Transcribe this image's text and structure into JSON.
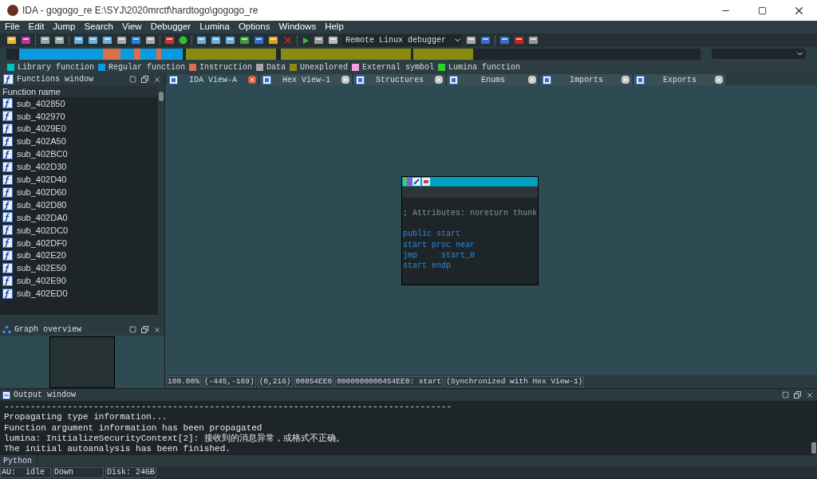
{
  "window": {
    "title": "IDA - gogogo_re E:\\SYJ\\2020mrctf\\hardtogo\\gogogo_re"
  },
  "menu": [
    "File",
    "Edit",
    "Jump",
    "Search",
    "View",
    "Debugger",
    "Lumina",
    "Options",
    "Windows",
    "Help"
  ],
  "toolbar": {
    "debugger": "Remote Linux debugger"
  },
  "legend": [
    {
      "label": "Library function",
      "color": "#00c0c0"
    },
    {
      "label": "Regular function",
      "color": "#0a9ae0"
    },
    {
      "label": "Instruction",
      "color": "#d9714e"
    },
    {
      "label": "Data",
      "color": "#a8a8a8"
    },
    {
      "label": "Unexplored",
      "color": "#8a8a10"
    },
    {
      "label": "External symbol",
      "color": "#f59ee8"
    },
    {
      "label": "Lumina function",
      "color": "#30d030"
    }
  ],
  "functions_window": {
    "title": "Functions window",
    "column": "Function name",
    "rows": [
      "sub_402850",
      "sub_402970",
      "sub_4029E0",
      "sub_402A50",
      "sub_402BC0",
      "sub_402D30",
      "sub_402D40",
      "sub_402D60",
      "sub_402D80",
      "sub_402DA0",
      "sub_402DC0",
      "sub_402DF0",
      "sub_402E20",
      "sub_402E50",
      "sub_402E90",
      "sub_402ED0"
    ]
  },
  "graph_overview": {
    "title": "Graph overview"
  },
  "tabs": [
    {
      "label": "IDA View-A",
      "selected": true
    },
    {
      "label": "Hex View-1",
      "selected": false
    },
    {
      "label": "Structures",
      "selected": false
    },
    {
      "label": "Enums",
      "selected": false
    },
    {
      "label": "Imports",
      "selected": false
    },
    {
      "label": "Exports",
      "selected": false
    }
  ],
  "graph_node": {
    "comment": "; Attributes: noreturn thunk",
    "lines": [
      "public start",
      "start proc near",
      "jmp     start_0",
      "start endp"
    ]
  },
  "graph_status": [
    "100.00%",
    "(-445,-169)",
    "(0,216)",
    "00054EE0",
    "0000000000454EE0: start",
    "(Synchronized with Hex View-1)"
  ],
  "output": {
    "title": "Output window",
    "lines": [
      "-------------------------------------------------------------------------------------",
      "Propagating type information...",
      "Function argument information has been propagated",
      "lumina: InitializeSecurityContext[2]: 接收到的消息异常，或格式不正确。",
      "The initial autoanalysis has been finished."
    ]
  },
  "python": {
    "label": "Python"
  },
  "status_bar": [
    "AU:  idle",
    "Down",
    "Disk: 24GB"
  ]
}
